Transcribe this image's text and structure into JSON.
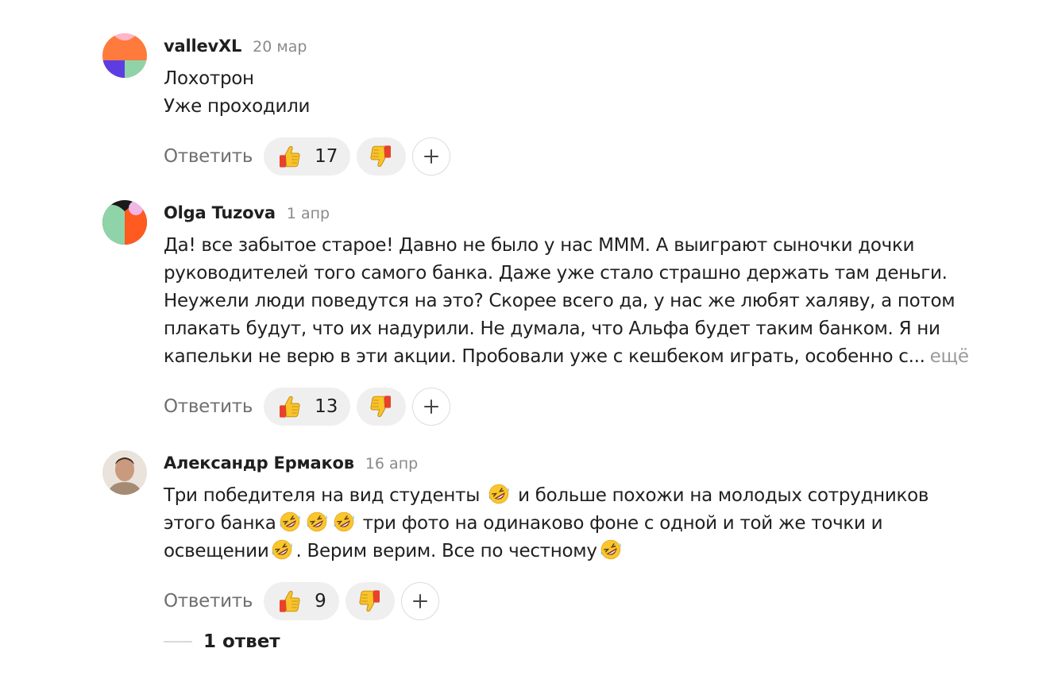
{
  "comments": [
    {
      "author": "vallevXL",
      "date": "20 мар",
      "lines": [
        "Лохотрон",
        "Уже проходили"
      ],
      "reply_label": "Ответить",
      "likes": "17"
    },
    {
      "author": "Olga Tuzova",
      "date": "1 апр",
      "lines": [
        "Да! все забытое старое! Давно не было у нас МММ. А выиграют сыночки дочки",
        "руководителей того самого банка. Даже уже стало страшно держать там деньги.",
        "Неужели люди поведутся на это? Скорее всего да, у нас же любят халяву, а потом",
        "плакать будут, что их надурили. Не думала, что Альфа будет таким банком. Я ни",
        "капельки не верю в эти акции. Пробовали уже с кешбеком играть, особенно с..."
      ],
      "more_label": "ещё",
      "reply_label": "Ответить",
      "likes": "13"
    },
    {
      "author": "Александр Ермаков",
      "date": "16 апр",
      "segments": {
        "l1a": "Три победителя на вид студенты ",
        "l1b": " и больше похожи на молодых сотрудников",
        "l2a": "этого банка",
        "l2b": " три фото на одинаково фоне с одной и той же точки и",
        "l3a": "освещении",
        "l3b": ". Верим верим. Все по честному"
      },
      "reply_label": "Ответить",
      "likes": "9"
    }
  ],
  "thread": {
    "replies_label": "1 ответ"
  },
  "icons": {
    "like": "thumbs-up-icon",
    "dislike": "thumbs-down-icon",
    "add": "plus-icon",
    "emoji": "rolling-on-floor-laughing-icon"
  },
  "colors": {
    "text": "#1f1f1f",
    "muted": "#6f6f6f",
    "date": "#8a8a8a",
    "pill": "#efefef"
  }
}
